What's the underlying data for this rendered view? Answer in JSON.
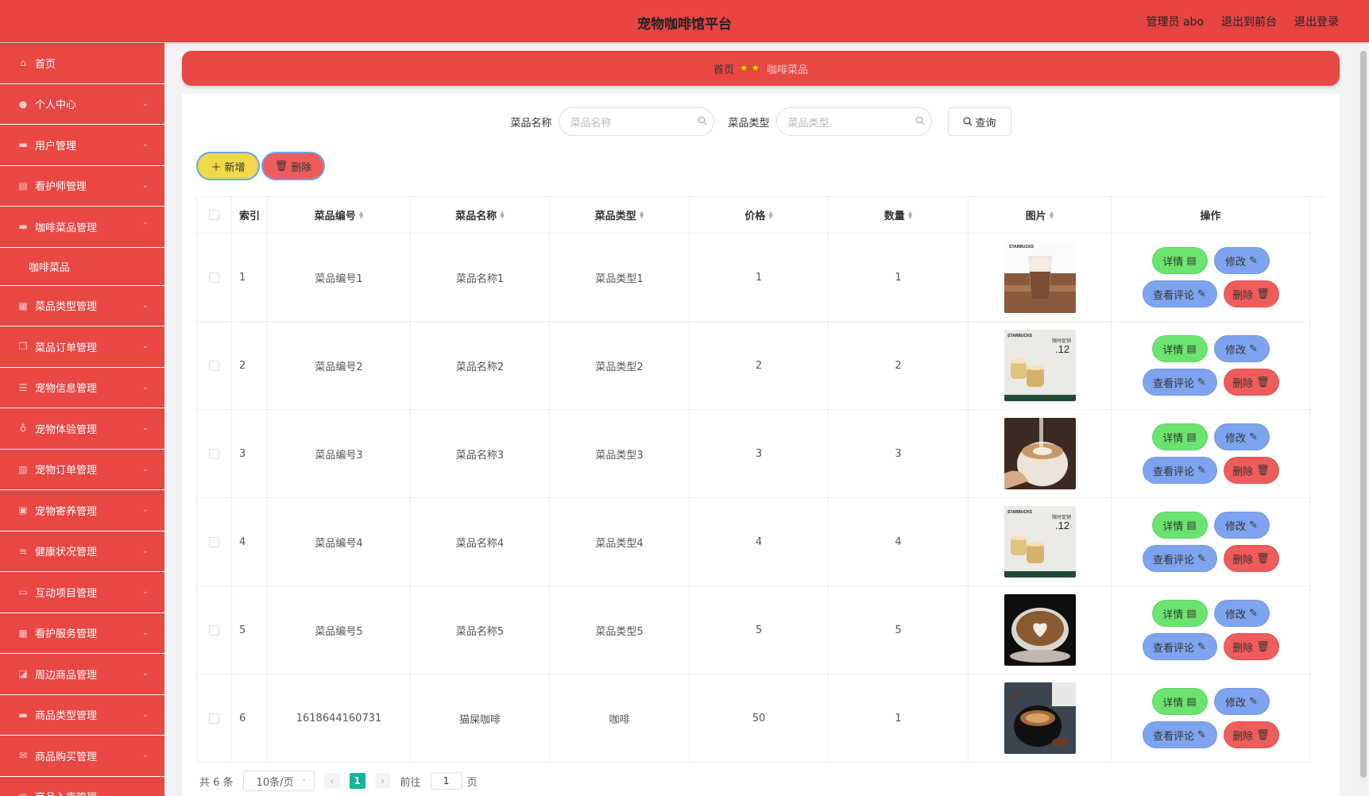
{
  "header": {
    "title": "宠物咖啡馆平台",
    "user": "管理员 abo",
    "to_front": "退出到前台",
    "logout": "退出登录"
  },
  "sidebar": {
    "items": [
      {
        "label": "首页",
        "icon": "home-icon"
      },
      {
        "label": "个人中心",
        "icon": "user-icon"
      },
      {
        "label": "用户管理",
        "icon": "users-icon"
      },
      {
        "label": "看护师管理",
        "icon": "clipboard-icon"
      },
      {
        "label": "咖啡菜品管理",
        "icon": "monitor-icon"
      },
      {
        "label": "咖啡菜品",
        "icon": ""
      },
      {
        "label": "菜品类型管理",
        "icon": "grid-icon"
      },
      {
        "label": "菜品订单管理",
        "icon": "copy-icon"
      },
      {
        "label": "宠物信息管理",
        "icon": "list-icon"
      },
      {
        "label": "宠物体验管理",
        "icon": "mic-icon"
      },
      {
        "label": "宠物订单管理",
        "icon": "bars-icon"
      },
      {
        "label": "宠物寄养管理",
        "icon": "chart-icon"
      },
      {
        "label": "健康状况管理",
        "icon": "sliders-icon"
      },
      {
        "label": "互动项目管理",
        "icon": "chat-icon"
      },
      {
        "label": "看护服务管理",
        "icon": "apps-icon"
      },
      {
        "label": "周边商品管理",
        "icon": "thumb-icon"
      },
      {
        "label": "商品类型管理",
        "icon": "monitor-icon"
      },
      {
        "label": "商品购买管理",
        "icon": "mail-icon"
      },
      {
        "label": "商品入库管理",
        "icon": "box-icon"
      }
    ]
  },
  "breadcrumb": {
    "home": "首页",
    "stars": "★★",
    "current": "咖啡菜品"
  },
  "search": {
    "name_label": "菜品名称",
    "name_placeholder": "菜品名称",
    "type_label": "菜品类型",
    "type_placeholder": "菜品类型",
    "query_button": "查询"
  },
  "actions": {
    "add": "新增",
    "delete": "删除"
  },
  "table": {
    "headers": [
      "索引",
      "菜品编号",
      "菜品名称",
      "菜品类型",
      "价格",
      "数量",
      "图片",
      "操作"
    ],
    "rows": [
      {
        "index": "1",
        "code": "菜品编号1",
        "name": "菜品名称1",
        "type": "菜品类型1",
        "price": "1",
        "qty": "1",
        "image": "frappuccino-cup"
      },
      {
        "index": "2",
        "code": "菜品编号2",
        "name": "菜品名称2",
        "type": "菜品类型2",
        "price": "2",
        "qty": "2",
        "image": "starbucks-pudding-ad"
      },
      {
        "index": "3",
        "code": "菜品编号3",
        "name": "菜品名称3",
        "type": "菜品类型3",
        "price": "3",
        "qty": "3",
        "image": "latte-pour"
      },
      {
        "index": "4",
        "code": "菜品编号4",
        "name": "菜品名称4",
        "type": "菜品类型4",
        "price": "4",
        "qty": "4",
        "image": "starbucks-pudding-ad"
      },
      {
        "index": "5",
        "code": "菜品编号5",
        "name": "菜品名称5",
        "type": "菜品类型5",
        "price": "5",
        "qty": "5",
        "image": "latte-art-heart"
      },
      {
        "index": "6",
        "code": "1618644160731",
        "name": "猫屎咖啡",
        "type": "咖啡",
        "price": "50",
        "qty": "1",
        "image": "espresso-cup"
      }
    ],
    "op_labels": {
      "detail": "详情",
      "edit": "修改",
      "comment": "查看评论",
      "delete": "删除"
    },
    "ad_text": {
      "brand": "STARBUCKS",
      "price": ".12",
      "promo": "限时促销"
    }
  },
  "pagination": {
    "total": "共 6 条",
    "page_size": "10条/页",
    "current_page": "1",
    "goto_label": "前往",
    "goto_value": "1",
    "page_suffix": "页"
  },
  "colors": {
    "brand_red": "#e84744",
    "add_yellow": "#f0d94a",
    "detail_green": "#6ce470",
    "edit_blue": "#7ea4ef",
    "pager_teal": "#17b39b"
  }
}
